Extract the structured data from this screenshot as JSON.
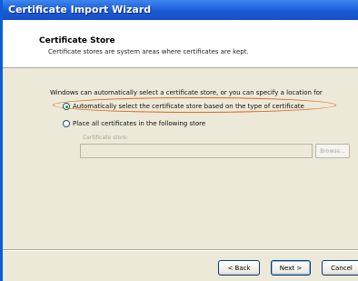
{
  "window": {
    "title": "Certificate Import Wizard"
  },
  "header": {
    "title": "Certificate Store",
    "description": "Certificate stores are system areas where certificates are kept."
  },
  "body": {
    "intro": "Windows can automatically select a certificate store, or you can specify a location for",
    "options": [
      {
        "label": "Automatically select the certificate store based on the type of certificate",
        "selected": true
      },
      {
        "label": "Place all certificates in the following store",
        "selected": false
      }
    ],
    "store": {
      "label": "Certificate store:",
      "value": "",
      "browse_label": "Browse..."
    },
    "annotation_color": "#e3641e"
  },
  "footer": {
    "back_label": "< Back",
    "next_label": "Next >",
    "cancel_label": "Cancel"
  }
}
